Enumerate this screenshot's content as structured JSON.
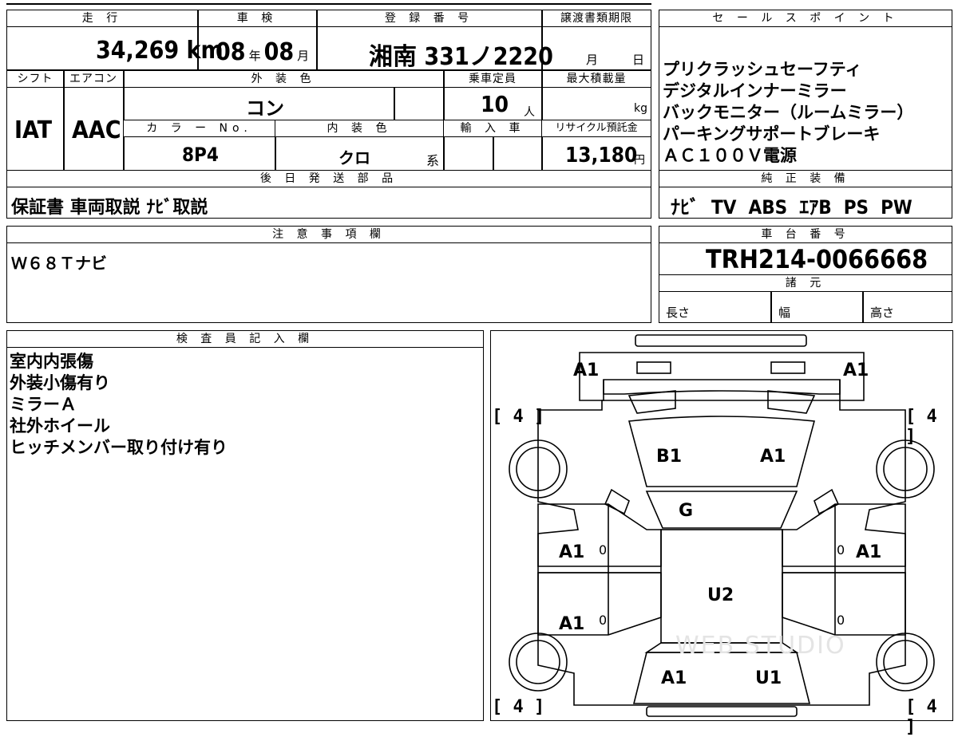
{
  "header": {
    "mileage_label": "走 行",
    "mileage_value": "34,269",
    "mileage_unit": "km",
    "inspection_label": "車 検",
    "inspection_year": "08",
    "inspection_year_unit": "年",
    "inspection_month": "08",
    "inspection_month_unit": "月",
    "registration_label": "登 録 番 号",
    "registration_area": "湘南",
    "registration_number": "331ノ2220",
    "transfer_label": "譲渡書類期限",
    "transfer_month_unit": "月",
    "transfer_day_unit": "日",
    "sales_label": "セ ー ル ス ポ イ ン ト"
  },
  "specs": {
    "shift_label": "シフト",
    "shift_value": "IAT",
    "ac_label": "エアコン",
    "ac_value": "AAC",
    "exterior_color_label": "外 装 色",
    "exterior_color_value": "コン",
    "capacity_label": "乗車定員",
    "capacity_value": "10",
    "capacity_unit": "人",
    "max_load_label": "最大積載量",
    "max_load_unit": "kg",
    "color_no_label": "カ ラ ー No.",
    "color_no_value": "8P4",
    "interior_color_label": "内 装 色",
    "interior_color_value": "クロ",
    "interior_color_suffix": "系",
    "import_label": "輸 入 車",
    "recycle_label": "リサイクル預託金",
    "recycle_value": "13,180",
    "recycle_unit": "円"
  },
  "sales_points": [
    "プリクラッシュセーフティ",
    "デジタルインナーミラー",
    "バックモニター（ルームミラー）",
    "パーキングサポートブレーキ",
    "ＡＣ１００Ｖ電源"
  ],
  "later_parts": {
    "label": "後 日 発 送 部 品",
    "value": "保証書 車両取説 ﾅﾋﾞ取説"
  },
  "genuine_equipment": {
    "label": "純 正 装 備",
    "value": "ﾅﾋﾞ  TV  ABS  ｴｱB  PS  PW"
  },
  "notes": {
    "label": "注 意 事 項 欄",
    "value": "Ｗ６８Ｔナビ"
  },
  "chassis": {
    "label": "車 台 番 号",
    "value": "TRH214-0066668",
    "specs_label": "諸 元",
    "length_label": "長さ",
    "width_label": "幅",
    "height_label": "高さ"
  },
  "inspector": {
    "label": "検 査 員 記 入 欄",
    "lines": [
      "室内内張傷",
      "外装小傷有り",
      "ミラーＡ",
      "社外ホイール",
      "ヒッチメンバー取り付け有り"
    ]
  },
  "diagram": {
    "labels": {
      "front_left_corner": "A1",
      "front_right_corner": "A1",
      "hood_left": "B1",
      "hood_right": "A1",
      "windshield": "G",
      "left_front_door": "A1",
      "right_front_door": "A1",
      "left_rear_door": "A1",
      "roof": "U2",
      "rear_left": "A1",
      "rear_right": "U1"
    },
    "tire_tread": {
      "front_left": "4",
      "front_right": "4",
      "rear_left": "4",
      "rear_right": "4"
    },
    "bracket_open": "[",
    "bracket_close": "]",
    "zero_mark": "0",
    "watermark": "WEB STUDIO"
  }
}
